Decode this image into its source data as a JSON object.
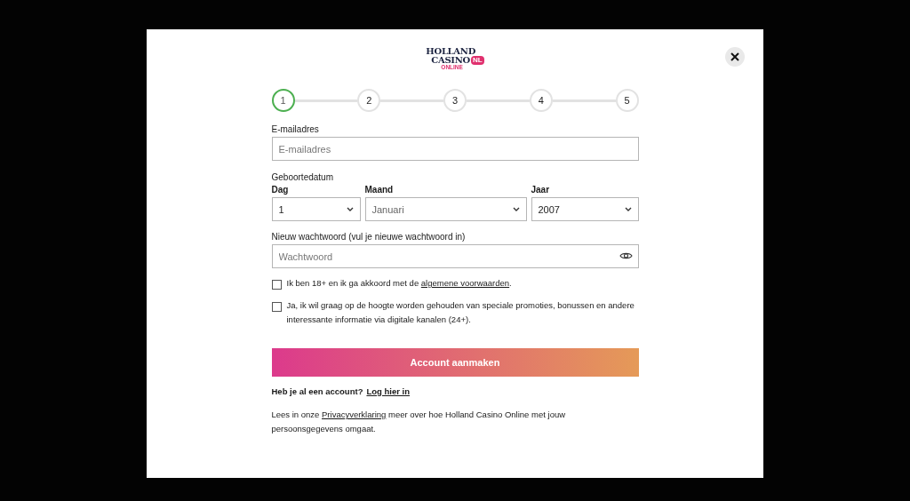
{
  "logo": {
    "line_1": "HOLLAND",
    "line_2": "CASINO",
    "line_3": "ONLINE",
    "badge": "NL"
  },
  "steps": [
    {
      "label": "1",
      "selected": true
    },
    {
      "label": "2",
      "selected": false
    },
    {
      "label": "3",
      "selected": false
    },
    {
      "label": "4",
      "selected": false
    },
    {
      "label": "5",
      "selected": false
    }
  ],
  "email": {
    "label": "E-mailadres",
    "placeholder": "E-mailadres"
  },
  "birthdate": {
    "label": "Geboortedatum",
    "selects": [
      {
        "label": "Dag",
        "value": "1",
        "placeholder": false
      },
      {
        "label": "Maand",
        "value": "Januari",
        "placeholder": true
      },
      {
        "label": "Jaar",
        "value": "2007",
        "placeholder": false
      }
    ]
  },
  "password": {
    "label": "Nieuw wachtwoord (vul je nieuwe wachtwoord in)",
    "placeholder": "Wachtwoord"
  },
  "checkboxes": [
    {
      "checked": false,
      "text": "Ik ben 18+ en ik ga akkoord met de ",
      "link": "algemene voorwaarden",
      "after": "."
    },
    {
      "checked": false,
      "text": "Ja, ik wil graag op de hoogte worden gehouden van speciale promoties, bonussen en andere interessante informatie via digitale kanalen (24+)."
    }
  ],
  "submit": "Account aanmaken",
  "login": {
    "text": "Heb je al een account?",
    "link": "Log hier in"
  },
  "privacy": {
    "before": "Lees in onze ",
    "link": "Privacyverklaring",
    "after": " meer over hoe Holland Casino Online met jouw persoonsgegevens omgaat."
  }
}
